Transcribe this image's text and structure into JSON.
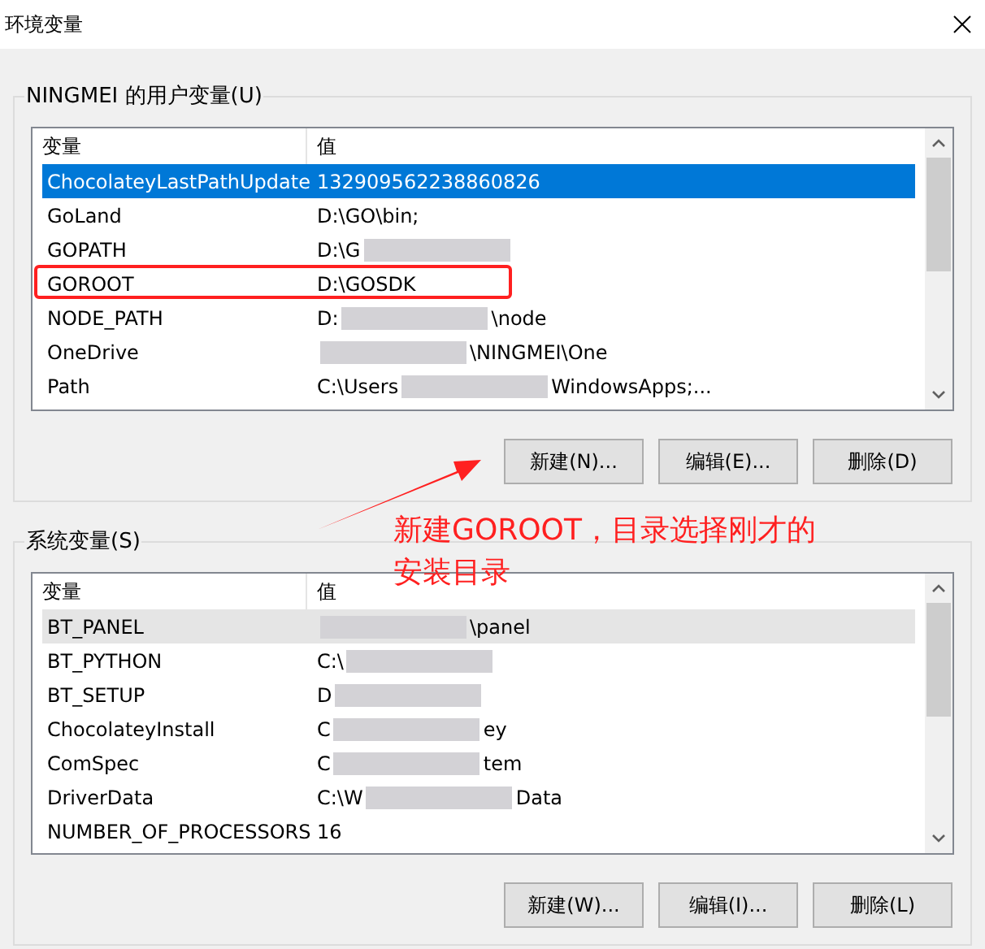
{
  "window": {
    "title": "环境变量"
  },
  "user_vars": {
    "title": "NINGMEI 的用户变量(U)",
    "columns": [
      "变量",
      "值"
    ],
    "rows": [
      {
        "name": "ChocolateyLastPathUpdate",
        "value": "132909562238860826",
        "redacted": false,
        "selected": true,
        "highlighted": false
      },
      {
        "name": "GoLand",
        "value": "D:\\GO\\bin;",
        "redacted": false,
        "selected": false,
        "highlighted": false
      },
      {
        "name": "GOPATH",
        "value": "D:\\G",
        "redacted": true,
        "selected": false,
        "highlighted": false
      },
      {
        "name": "GOROOT",
        "value": "D:\\GOSDK",
        "redacted": false,
        "selected": false,
        "highlighted": true
      },
      {
        "name": "NODE_PATH",
        "value": "D:",
        "tail": "\\node",
        "redacted": true,
        "selected": false,
        "highlighted": false
      },
      {
        "name": "OneDrive",
        "value": "",
        "tail": "\\NINGMEI\\One",
        "redacted": true,
        "selected": false,
        "highlighted": false
      },
      {
        "name": "Path",
        "value": "C:\\Users",
        "tail": "WindowsApps;...",
        "redacted": true,
        "selected": false,
        "highlighted": false
      }
    ],
    "buttons": [
      "新建(N)...",
      "编辑(E)...",
      "删除(D)"
    ]
  },
  "system_vars": {
    "title": "系统变量(S)",
    "columns": [
      "变量",
      "值"
    ],
    "rows": [
      {
        "name": "BT_PANEL",
        "value": "",
        "tail": "\\panel",
        "redacted": true,
        "selected": false,
        "hovered": true
      },
      {
        "name": "BT_PYTHON",
        "value": "C:\\",
        "redacted": true,
        "selected": false,
        "hovered": false
      },
      {
        "name": "BT_SETUP",
        "value": "D",
        "redacted": true,
        "selected": false,
        "hovered": false
      },
      {
        "name": "ChocolateyInstall",
        "value": "C",
        "tail": "ey",
        "redacted": true,
        "selected": false,
        "hovered": false
      },
      {
        "name": "ComSpec",
        "value": "C",
        "tail": "tem",
        "redacted": true,
        "selected": false,
        "hovered": false
      },
      {
        "name": "DriverData",
        "value": "C:\\W",
        "tail": "Data",
        "redacted": true,
        "selected": false,
        "hovered": false
      },
      {
        "name": "NUMBER_OF_PROCESSORS",
        "value": "16",
        "redacted": false,
        "selected": false,
        "hovered": false
      }
    ],
    "buttons": [
      "新建(W)...",
      "编辑(I)...",
      "删除(L)"
    ]
  },
  "annotation": {
    "text": "新建GOROOT，目录选择刚才的安装目录"
  }
}
